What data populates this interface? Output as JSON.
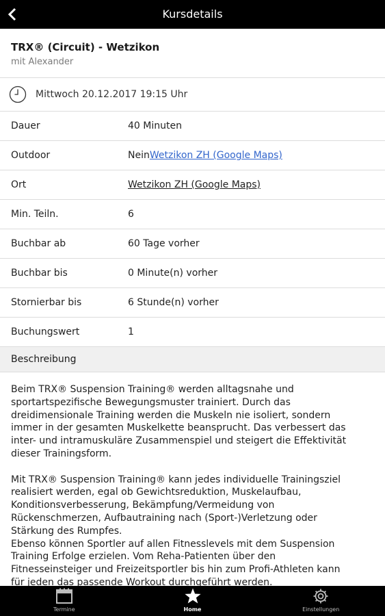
{
  "header": {
    "title": "Kursdetails",
    "back_icon": "chevron-left-icon"
  },
  "course": {
    "title": "TRX® (Circuit) - Wetzikon",
    "trainer": "mit Alexander"
  },
  "schedule": {
    "icon": "clock-icon",
    "date": "Mittwoch 20.12.2017 19:15 Uhr"
  },
  "details": {
    "duration": {
      "label": "Dauer",
      "value": "40 Minuten"
    },
    "outdoor": {
      "label": "Outdoor",
      "value": "Nein",
      "link": "Wetzikon ZH (Google Maps)"
    },
    "location": {
      "label": "Ort",
      "link": "Wetzikon ZH (Google Maps)"
    },
    "min_participants": {
      "label": "Min. Teiln.",
      "value": "6"
    },
    "bookable_from": {
      "label": "Buchbar ab",
      "value": "60 Tage vorher"
    },
    "bookable_until": {
      "label": "Buchbar bis",
      "value": "0 Minute(n) vorher"
    },
    "cancellable_until": {
      "label": "Stornierbar bis",
      "value": "6 Stunde(n) vorher"
    },
    "booking_value": {
      "label": "Buchungswert",
      "value": "1"
    }
  },
  "description": {
    "heading": "Beschreibung",
    "paragraph1": "Beim TRX® Suspension Training® werden alltagsnahe und\nsportartspezifische Bewegungsmuster trainiert. Durch das\ndreidimensionale Training werden die Muskeln nie isoliert, sondern\nimmer in der gesamten Muskelkette beansprucht. Das verbessert das\ninter- und intramuskuläre Zusammenspiel und steigert die Effektivität\ndieser Trainingsform.",
    "paragraph2": "Mit TRX® Suspension Training® kann jedes individuelle Trainingsziel\nrealisiert werden, egal ob Gewichtsreduktion, Muskelaufbau,\nKonditionsverbesserung, Bekämpfung/Vermeidung von\nRückenschmerzen, Aufbautraining nach (Sport-)Verletzung oder\nStärkung des Rumpfes.\nEbenso können Sportler auf allen Fitnesslevels mit dem Suspension\nTraining Erfolge erzielen. Vom Reha-Patienten über den\nFitnesseinsteiger und Freizeitsportler bis hin zum Profi-Athleten kann\nfür jeden das passende Workout durchgeführt werden."
  },
  "tabbar": {
    "tabs": [
      {
        "label": "Termine",
        "icon": "calendar-icon",
        "active": false
      },
      {
        "label": "Home",
        "icon": "star-icon",
        "active": true
      },
      {
        "label": "Einstellungen",
        "icon": "gear-icon",
        "active": false
      }
    ]
  },
  "colors": {
    "bar_background": "#000000",
    "link": "#3366cc",
    "section_background": "#f0f0f0",
    "divider": "#dcdcdc"
  }
}
